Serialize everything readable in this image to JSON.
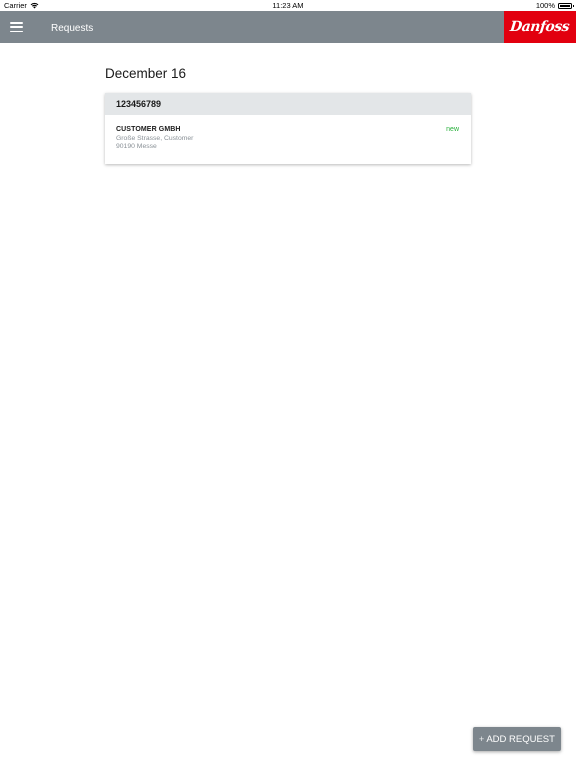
{
  "status_bar": {
    "carrier": "Carrier",
    "time": "11:23 AM",
    "battery": "100%",
    "wifi_icon": "wifi-icon",
    "battery_icon": "battery-icon"
  },
  "nav": {
    "title": "Requests",
    "menu_icon": "hamburger-menu-icon",
    "logo_text": "Danfoss",
    "logo_color": "#e2000f",
    "bar_color": "#7d868d"
  },
  "requests": {
    "date": "December 16",
    "items": [
      {
        "id": "123456789",
        "customer": "CUSTOMER GMBH",
        "address_line1": "Große Strasse, Customer",
        "address_line2": "90190 Messe",
        "status": "new",
        "status_color": "#27b03a"
      }
    ]
  },
  "actions": {
    "add_icon": "+",
    "add_label": "ADD REQUEST"
  }
}
